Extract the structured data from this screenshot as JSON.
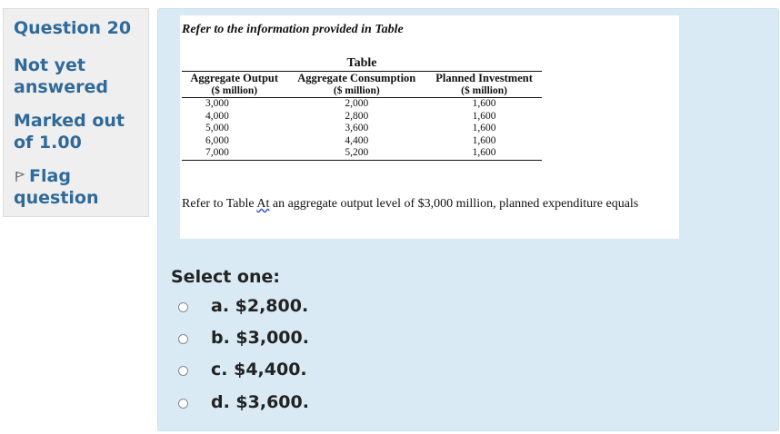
{
  "info": {
    "question_number": "Question 20",
    "state": [
      "Not yet",
      "answered"
    ],
    "grade": [
      "Marked out",
      "of 1.00"
    ],
    "flag": [
      "Flag",
      "question"
    ]
  },
  "question": {
    "lead": "Refer to the information provided in Table",
    "table_caption": "Table",
    "columns": [
      {
        "name": "Aggregate Output",
        "unit": "($ million)"
      },
      {
        "name": "Aggregate Consumption",
        "unit": "($ million)"
      },
      {
        "name": "Planned Investment",
        "unit": "($ million)"
      }
    ],
    "rows": [
      [
        "3,000",
        "2,000",
        "1,600"
      ],
      [
        "4,000",
        "2,800",
        "1,600"
      ],
      [
        "5,000",
        "3,600",
        "1,600"
      ],
      [
        "6,000",
        "4,400",
        "1,600"
      ],
      [
        "7,000",
        "5,200",
        "1,600"
      ]
    ],
    "text_pre": "Refer to Table ",
    "text_squiggle": "At",
    "text_post": " an aggregate output level of $3,000 million, planned expenditure equals"
  },
  "answer": {
    "prompt": "Select one:",
    "options": [
      "a. $2,800.",
      "b. $3,000.",
      "c. $4,400.",
      "d. $3,600."
    ]
  }
}
